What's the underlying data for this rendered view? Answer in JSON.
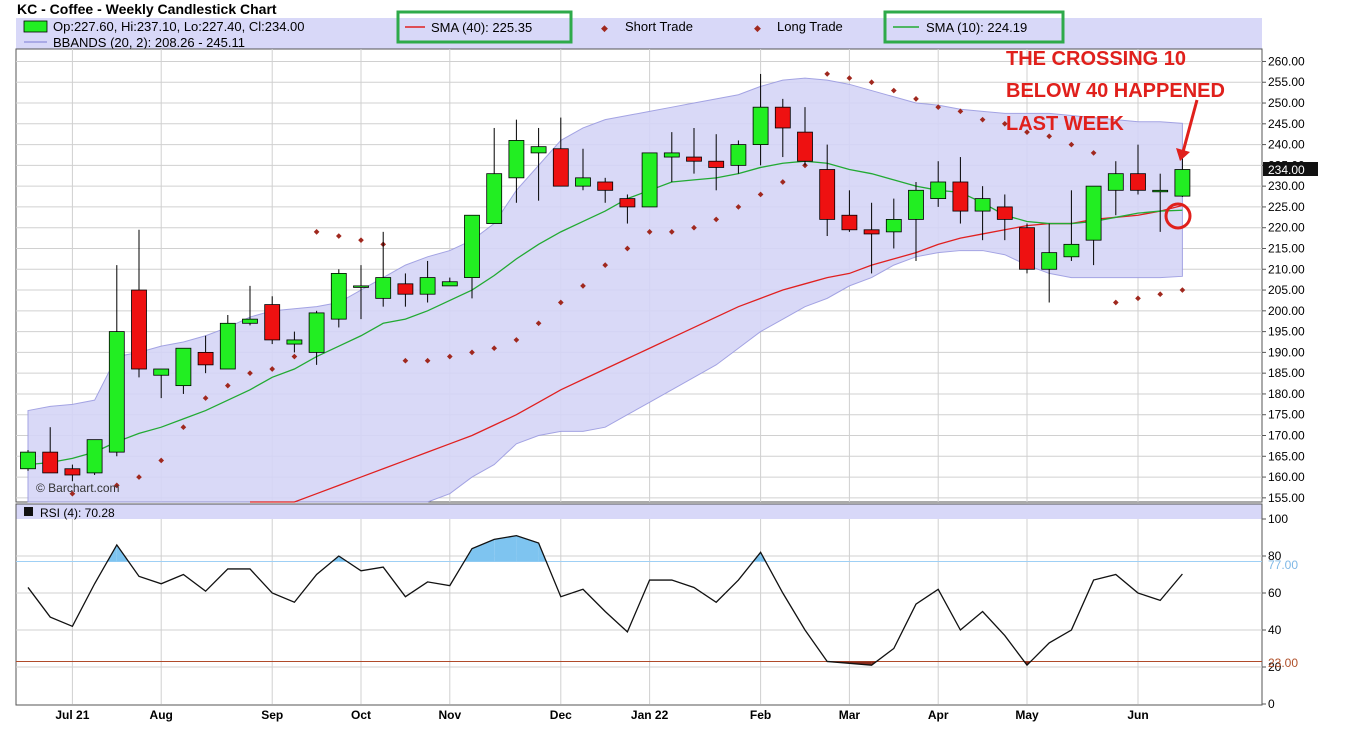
{
  "header": {
    "title": "KC - Coffee - Weekly Candlestick Chart",
    "ohlc": "Op:227.60, Hi:237.10, Lo:227.40, Cl:234.00",
    "bbands": "BBANDS (20, 2): 208.26 - 245.11",
    "sma40": "SMA (40): 225.35",
    "short_trade": "Short Trade",
    "long_trade": "Long Trade",
    "sma10": "SMA (10): 224.19"
  },
  "watermark": "© Barchart.com",
  "price_badge": "234.00",
  "annotation": {
    "lines": [
      "THE CROSSING 10",
      "BELOW 40 HAPPENED",
      "LAST WEEK"
    ]
  },
  "rsi_panel": {
    "label": "RSI (4): 70.28",
    "levels": [
      "77.00",
      "23.00"
    ]
  },
  "colors": {
    "up": "#22ee22",
    "down": "#ee1111",
    "band_fill": "#d5d5f7",
    "band_line": "#9a9ae0",
    "sma10": "#22aa33",
    "sma40": "#e02020",
    "sar": "#a0281e",
    "rsi": "#111111",
    "rsi_overbought_fill": "#7ec4f0",
    "rsi_oversold_fill": "#8a2a1a",
    "highlight_box": "#2eaa4a",
    "annotation": "#e0201c"
  },
  "chart_data": [
    {
      "type": "candlestick",
      "title": "KC - Coffee - Weekly Candlestick Chart",
      "x_tick_labels": [
        "Jul 21",
        "Aug",
        "Sep",
        "Oct",
        "Nov",
        "Dec",
        "Jan 22",
        "Feb",
        "Mar",
        "Apr",
        "May",
        "Jun"
      ],
      "x_tick_index": [
        2,
        6,
        11,
        15,
        19,
        24,
        28,
        33,
        37,
        41,
        45,
        50
      ],
      "y_ticks": [
        "155.00",
        "160.00",
        "165.00",
        "170.00",
        "175.00",
        "180.00",
        "185.00",
        "190.00",
        "195.00",
        "200.00",
        "205.00",
        "210.00",
        "215.00",
        "220.00",
        "225.00",
        "230.00",
        "235.00",
        "240.00",
        "245.00",
        "250.00",
        "255.00",
        "260.00"
      ],
      "ylim": [
        154,
        263
      ],
      "grid": true,
      "candles": [
        {
          "o": 162,
          "h": 166.5,
          "l": 161.5,
          "c": 166
        },
        {
          "o": 166,
          "h": 172,
          "l": 161,
          "c": 161
        },
        {
          "o": 162,
          "h": 163,
          "l": 159,
          "c": 160.5
        },
        {
          "o": 161,
          "h": 169,
          "l": 160.5,
          "c": 169
        },
        {
          "o": 166,
          "h": 211,
          "l": 165,
          "c": 195
        },
        {
          "o": 205,
          "h": 219.5,
          "l": 184,
          "c": 186
        },
        {
          "o": 184.5,
          "h": 186,
          "l": 179,
          "c": 186
        },
        {
          "o": 182,
          "h": 191,
          "l": 180,
          "c": 191
        },
        {
          "o": 190,
          "h": 194,
          "l": 185,
          "c": 187
        },
        {
          "o": 186,
          "h": 199,
          "l": 186,
          "c": 197
        },
        {
          "o": 197,
          "h": 206,
          "l": 196.5,
          "c": 198
        },
        {
          "o": 201.5,
          "h": 203.5,
          "l": 192,
          "c": 193
        },
        {
          "o": 192,
          "h": 195,
          "l": 190,
          "c": 193
        },
        {
          "o": 190,
          "h": 200,
          "l": 187,
          "c": 199.5
        },
        {
          "o": 198,
          "h": 210,
          "l": 196,
          "c": 209
        },
        {
          "o": 206,
          "h": 211,
          "l": 198,
          "c": 206
        },
        {
          "o": 203,
          "h": 219,
          "l": 201,
          "c": 208
        },
        {
          "o": 206.5,
          "h": 209,
          "l": 201,
          "c": 204
        },
        {
          "o": 204,
          "h": 212,
          "l": 202,
          "c": 208
        },
        {
          "o": 206,
          "h": 208,
          "l": 206,
          "c": 207
        },
        {
          "o": 208,
          "h": 223,
          "l": 203,
          "c": 223
        },
        {
          "o": 221,
          "h": 244,
          "l": 221,
          "c": 233
        },
        {
          "o": 232,
          "h": 246,
          "l": 226,
          "c": 241
        },
        {
          "o": 238,
          "h": 244,
          "l": 226.5,
          "c": 239.5
        },
        {
          "o": 239,
          "h": 246.5,
          "l": 230,
          "c": 230
        },
        {
          "o": 230,
          "h": 239,
          "l": 229,
          "c": 232
        },
        {
          "o": 231,
          "h": 232,
          "l": 226,
          "c": 229
        },
        {
          "o": 227,
          "h": 228,
          "l": 221,
          "c": 225
        },
        {
          "o": 225,
          "h": 238,
          "l": 225,
          "c": 238
        },
        {
          "o": 237,
          "h": 243,
          "l": 231,
          "c": 238
        },
        {
          "o": 237,
          "h": 244,
          "l": 233,
          "c": 236
        },
        {
          "o": 236,
          "h": 242.5,
          "l": 229,
          "c": 234.5
        },
        {
          "o": 235,
          "h": 241,
          "l": 233,
          "c": 240
        },
        {
          "o": 240,
          "h": 257,
          "l": 235,
          "c": 249
        },
        {
          "o": 249,
          "h": 251,
          "l": 237,
          "c": 244
        },
        {
          "o": 243,
          "h": 249,
          "l": 235,
          "c": 236
        },
        {
          "o": 234,
          "h": 240,
          "l": 218,
          "c": 222
        },
        {
          "o": 223,
          "h": 229,
          "l": 219,
          "c": 219.5
        },
        {
          "o": 219.5,
          "h": 226,
          "l": 209,
          "c": 218.5
        },
        {
          "o": 219,
          "h": 227,
          "l": 215,
          "c": 222
        },
        {
          "o": 222,
          "h": 231,
          "l": 212,
          "c": 229
        },
        {
          "o": 227,
          "h": 236,
          "l": 225,
          "c": 231
        },
        {
          "o": 231,
          "h": 237,
          "l": 221,
          "c": 224
        },
        {
          "o": 224,
          "h": 230,
          "l": 217,
          "c": 227
        },
        {
          "o": 225,
          "h": 228,
          "l": 217,
          "c": 222
        },
        {
          "o": 220,
          "h": 221,
          "l": 209,
          "c": 210
        },
        {
          "o": 210,
          "h": 221,
          "l": 202,
          "c": 214
        },
        {
          "o": 213,
          "h": 229,
          "l": 212,
          "c": 216
        },
        {
          "o": 217,
          "h": 230,
          "l": 211,
          "c": 230
        },
        {
          "o": 229,
          "h": 236,
          "l": 223,
          "c": 233
        },
        {
          "o": 233,
          "h": 240,
          "l": 228,
          "c": 229
        },
        {
          "o": 229,
          "h": 233,
          "l": 219,
          "c": 229
        },
        {
          "o": 227.6,
          "h": 237.1,
          "l": 227.4,
          "c": 234
        }
      ],
      "bollinger_upper": [
        176,
        177,
        177.5,
        178.5,
        189,
        190,
        191.5,
        192.5,
        194,
        196,
        198.5,
        200,
        200.5,
        201,
        202,
        205,
        208,
        211,
        213,
        214.5,
        217,
        221,
        229,
        235,
        241,
        244,
        246,
        247,
        248,
        249,
        250,
        251,
        252,
        254,
        255.5,
        256,
        255.5,
        254.5,
        253,
        251.5,
        250,
        249.5,
        248.5,
        248,
        247.5,
        247.5,
        247.5,
        247,
        246.5,
        246,
        245.5,
        245.5,
        245.1
      ],
      "bollinger_lower": [
        153,
        153,
        153,
        153,
        150,
        151,
        151,
        151,
        150,
        150,
        150,
        150,
        150,
        150,
        150,
        150,
        152,
        153,
        154,
        156,
        160,
        163,
        168,
        170,
        171,
        171,
        172,
        175,
        178,
        181,
        184,
        187,
        191,
        195,
        198,
        201,
        203,
        206,
        208,
        211,
        213,
        214,
        214.5,
        214.5,
        213.5,
        211,
        209,
        208,
        208,
        208,
        208,
        208,
        208.3
      ],
      "sma10": [
        163,
        163.5,
        164.5,
        166,
        168.5,
        170.5,
        172,
        174,
        176,
        178.5,
        181,
        184,
        186,
        189,
        191.5,
        194,
        197,
        198,
        200,
        202.5,
        205,
        208.5,
        212.5,
        216,
        219,
        221.5,
        224,
        227,
        229,
        231,
        231.5,
        232,
        233,
        234.5,
        235.5,
        236,
        235.5,
        234,
        233,
        231.5,
        230,
        229,
        228.5,
        226,
        223,
        221.5,
        221,
        221,
        221.5,
        222.5,
        223.5,
        224,
        224.2
      ],
      "sma40": [
        null,
        null,
        null,
        null,
        null,
        null,
        null,
        null,
        null,
        null,
        150,
        152,
        154,
        156,
        158,
        160,
        162,
        164,
        166,
        168,
        170,
        172.5,
        175,
        178,
        181,
        183.5,
        186,
        188.5,
        191,
        193.5,
        196,
        198.5,
        201,
        203,
        205,
        206.5,
        208,
        209,
        211,
        212.5,
        214,
        216,
        217.5,
        218.5,
        219.5,
        220.5,
        221,
        221,
        222,
        222.5,
        223,
        224,
        225.35
      ],
      "sar": [
        {
          "i": 2,
          "v": 156
        },
        {
          "i": 4,
          "v": 158
        },
        {
          "i": 5,
          "v": 160
        },
        {
          "i": 6,
          "v": 164
        },
        {
          "i": 7,
          "v": 172
        },
        {
          "i": 8,
          "v": 179
        },
        {
          "i": 9,
          "v": 182
        },
        {
          "i": 10,
          "v": 185
        },
        {
          "i": 11,
          "v": 186
        },
        {
          "i": 12,
          "v": 189
        },
        {
          "i": 13,
          "v": 219
        },
        {
          "i": 14,
          "v": 218
        },
        {
          "i": 15,
          "v": 217
        },
        {
          "i": 16,
          "v": 216
        },
        {
          "i": 17,
          "v": 188
        },
        {
          "i": 18,
          "v": 188
        },
        {
          "i": 19,
          "v": 189
        },
        {
          "i": 20,
          "v": 190
        },
        {
          "i": 21,
          "v": 191
        },
        {
          "i": 22,
          "v": 193
        },
        {
          "i": 23,
          "v": 197
        },
        {
          "i": 24,
          "v": 202
        },
        {
          "i": 25,
          "v": 206
        },
        {
          "i": 26,
          "v": 211
        },
        {
          "i": 27,
          "v": 215
        },
        {
          "i": 28,
          "v": 219
        },
        {
          "i": 29,
          "v": 219
        },
        {
          "i": 30,
          "v": 220
        },
        {
          "i": 31,
          "v": 222
        },
        {
          "i": 32,
          "v": 225
        },
        {
          "i": 33,
          "v": 228
        },
        {
          "i": 34,
          "v": 231
        },
        {
          "i": 35,
          "v": 235
        },
        {
          "i": 36,
          "v": 257
        },
        {
          "i": 37,
          "v": 256
        },
        {
          "i": 38,
          "v": 255
        },
        {
          "i": 39,
          "v": 253
        },
        {
          "i": 40,
          "v": 251
        },
        {
          "i": 41,
          "v": 249
        },
        {
          "i": 42,
          "v": 248
        },
        {
          "i": 43,
          "v": 246
        },
        {
          "i": 44,
          "v": 245
        },
        {
          "i": 45,
          "v": 243
        },
        {
          "i": 46,
          "v": 242
        },
        {
          "i": 47,
          "v": 240
        },
        {
          "i": 48,
          "v": 238
        },
        {
          "i": 49,
          "v": 202
        },
        {
          "i": 50,
          "v": 203
        },
        {
          "i": 51,
          "v": 204
        },
        {
          "i": 52,
          "v": 205
        }
      ]
    },
    {
      "type": "line",
      "title": "RSI (4): 70.28",
      "y_ticks": [
        "0",
        "20",
        "40",
        "60",
        "80",
        "100"
      ],
      "ylim": [
        0,
        100
      ],
      "levels": [
        77,
        23
      ],
      "values": [
        63,
        47,
        42,
        65,
        86,
        69,
        65,
        70,
        61,
        73,
        73,
        60,
        55,
        70,
        80,
        72,
        74,
        58,
        66,
        64,
        84,
        89,
        91,
        87,
        58,
        62,
        50,
        39,
        67,
        67,
        63,
        55,
        67,
        82,
        60,
        40,
        23,
        22,
        21,
        30,
        54,
        62,
        40,
        50,
        37,
        21,
        33,
        40,
        67,
        70,
        60,
        56,
        70.28
      ]
    }
  ]
}
